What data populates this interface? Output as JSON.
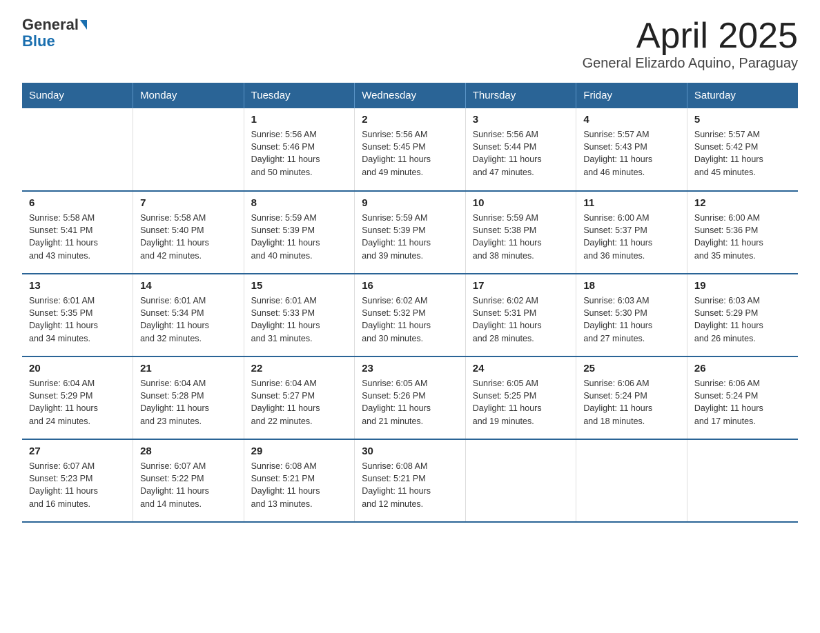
{
  "logo": {
    "general": "General",
    "blue": "Blue"
  },
  "title": "April 2025",
  "subtitle": "General Elizardo Aquino, Paraguay",
  "weekdays": [
    "Sunday",
    "Monday",
    "Tuesday",
    "Wednesday",
    "Thursday",
    "Friday",
    "Saturday"
  ],
  "weeks": [
    [
      {
        "day": "",
        "info": ""
      },
      {
        "day": "",
        "info": ""
      },
      {
        "day": "1",
        "info": "Sunrise: 5:56 AM\nSunset: 5:46 PM\nDaylight: 11 hours\nand 50 minutes."
      },
      {
        "day": "2",
        "info": "Sunrise: 5:56 AM\nSunset: 5:45 PM\nDaylight: 11 hours\nand 49 minutes."
      },
      {
        "day": "3",
        "info": "Sunrise: 5:56 AM\nSunset: 5:44 PM\nDaylight: 11 hours\nand 47 minutes."
      },
      {
        "day": "4",
        "info": "Sunrise: 5:57 AM\nSunset: 5:43 PM\nDaylight: 11 hours\nand 46 minutes."
      },
      {
        "day": "5",
        "info": "Sunrise: 5:57 AM\nSunset: 5:42 PM\nDaylight: 11 hours\nand 45 minutes."
      }
    ],
    [
      {
        "day": "6",
        "info": "Sunrise: 5:58 AM\nSunset: 5:41 PM\nDaylight: 11 hours\nand 43 minutes."
      },
      {
        "day": "7",
        "info": "Sunrise: 5:58 AM\nSunset: 5:40 PM\nDaylight: 11 hours\nand 42 minutes."
      },
      {
        "day": "8",
        "info": "Sunrise: 5:59 AM\nSunset: 5:39 PM\nDaylight: 11 hours\nand 40 minutes."
      },
      {
        "day": "9",
        "info": "Sunrise: 5:59 AM\nSunset: 5:39 PM\nDaylight: 11 hours\nand 39 minutes."
      },
      {
        "day": "10",
        "info": "Sunrise: 5:59 AM\nSunset: 5:38 PM\nDaylight: 11 hours\nand 38 minutes."
      },
      {
        "day": "11",
        "info": "Sunrise: 6:00 AM\nSunset: 5:37 PM\nDaylight: 11 hours\nand 36 minutes."
      },
      {
        "day": "12",
        "info": "Sunrise: 6:00 AM\nSunset: 5:36 PM\nDaylight: 11 hours\nand 35 minutes."
      }
    ],
    [
      {
        "day": "13",
        "info": "Sunrise: 6:01 AM\nSunset: 5:35 PM\nDaylight: 11 hours\nand 34 minutes."
      },
      {
        "day": "14",
        "info": "Sunrise: 6:01 AM\nSunset: 5:34 PM\nDaylight: 11 hours\nand 32 minutes."
      },
      {
        "day": "15",
        "info": "Sunrise: 6:01 AM\nSunset: 5:33 PM\nDaylight: 11 hours\nand 31 minutes."
      },
      {
        "day": "16",
        "info": "Sunrise: 6:02 AM\nSunset: 5:32 PM\nDaylight: 11 hours\nand 30 minutes."
      },
      {
        "day": "17",
        "info": "Sunrise: 6:02 AM\nSunset: 5:31 PM\nDaylight: 11 hours\nand 28 minutes."
      },
      {
        "day": "18",
        "info": "Sunrise: 6:03 AM\nSunset: 5:30 PM\nDaylight: 11 hours\nand 27 minutes."
      },
      {
        "day": "19",
        "info": "Sunrise: 6:03 AM\nSunset: 5:29 PM\nDaylight: 11 hours\nand 26 minutes."
      }
    ],
    [
      {
        "day": "20",
        "info": "Sunrise: 6:04 AM\nSunset: 5:29 PM\nDaylight: 11 hours\nand 24 minutes."
      },
      {
        "day": "21",
        "info": "Sunrise: 6:04 AM\nSunset: 5:28 PM\nDaylight: 11 hours\nand 23 minutes."
      },
      {
        "day": "22",
        "info": "Sunrise: 6:04 AM\nSunset: 5:27 PM\nDaylight: 11 hours\nand 22 minutes."
      },
      {
        "day": "23",
        "info": "Sunrise: 6:05 AM\nSunset: 5:26 PM\nDaylight: 11 hours\nand 21 minutes."
      },
      {
        "day": "24",
        "info": "Sunrise: 6:05 AM\nSunset: 5:25 PM\nDaylight: 11 hours\nand 19 minutes."
      },
      {
        "day": "25",
        "info": "Sunrise: 6:06 AM\nSunset: 5:24 PM\nDaylight: 11 hours\nand 18 minutes."
      },
      {
        "day": "26",
        "info": "Sunrise: 6:06 AM\nSunset: 5:24 PM\nDaylight: 11 hours\nand 17 minutes."
      }
    ],
    [
      {
        "day": "27",
        "info": "Sunrise: 6:07 AM\nSunset: 5:23 PM\nDaylight: 11 hours\nand 16 minutes."
      },
      {
        "day": "28",
        "info": "Sunrise: 6:07 AM\nSunset: 5:22 PM\nDaylight: 11 hours\nand 14 minutes."
      },
      {
        "day": "29",
        "info": "Sunrise: 6:08 AM\nSunset: 5:21 PM\nDaylight: 11 hours\nand 13 minutes."
      },
      {
        "day": "30",
        "info": "Sunrise: 6:08 AM\nSunset: 5:21 PM\nDaylight: 11 hours\nand 12 minutes."
      },
      {
        "day": "",
        "info": ""
      },
      {
        "day": "",
        "info": ""
      },
      {
        "day": "",
        "info": ""
      }
    ]
  ]
}
